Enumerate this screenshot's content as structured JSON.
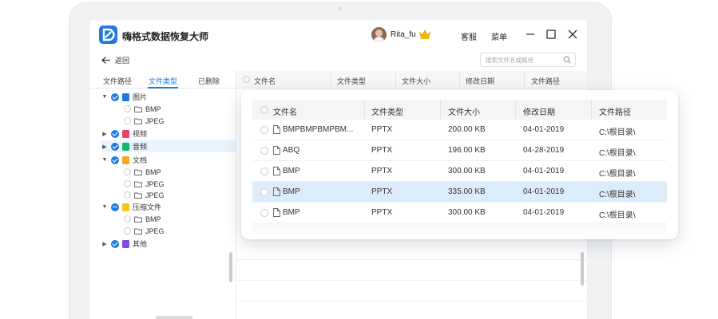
{
  "app": {
    "title": "嗨格式数据恢复大师",
    "user": "Rita_fu",
    "service_label": "客服",
    "menu_label": "菜单"
  },
  "nav": {
    "back_label": "返回",
    "search_placeholder": "搜索文件名或路径"
  },
  "left_tabs": [
    {
      "label": "文件路径",
      "active": false
    },
    {
      "label": "文件类型",
      "active": true
    },
    {
      "label": "已删除",
      "active": false
    }
  ],
  "tree": [
    {
      "label": "图片",
      "expanded": true,
      "checked": true,
      "color": "#1f7ae0"
    },
    {
      "label": "BMP",
      "child": true
    },
    {
      "label": "JPEG",
      "child": true
    },
    {
      "label": "视频",
      "expanded": false,
      "checked": true,
      "color": "#e8436f"
    },
    {
      "label": "音频",
      "expanded": false,
      "checked": true,
      "color": "#19b36b"
    },
    {
      "label": "文档",
      "expanded": true,
      "checked": true,
      "color": "#f5a623"
    },
    {
      "label": "BMP",
      "child": true
    },
    {
      "label": "JPEG",
      "child": true
    },
    {
      "label": "JPEG",
      "child": true
    },
    {
      "label": "压缩文件",
      "expanded": true,
      "checked": "partial",
      "color": "#f5c518"
    },
    {
      "label": "BMP",
      "child": true
    },
    {
      "label": "JPEG",
      "child": true
    },
    {
      "label": "其他",
      "expanded": false,
      "checked": true,
      "color": "#7b4fe0"
    }
  ],
  "bg_columns": [
    "文件名",
    "文件类型",
    "文件大小",
    "修改日期",
    "文件路径"
  ],
  "card": {
    "columns": [
      "文件名",
      "文件类型",
      "文件大小",
      "修改日期",
      "文件路径"
    ],
    "rows": [
      {
        "name": "BMPBMPBMPBM...",
        "type": "PPTX",
        "size": "200.00 KB",
        "date": "04-01-2019",
        "path": "C:\\根目录\\",
        "selected": false
      },
      {
        "name": "ABQ",
        "type": "PPTX",
        "size": "196.00 KB",
        "date": "04-28-2019",
        "path": "C:\\根目录\\",
        "selected": false
      },
      {
        "name": "BMP",
        "type": "PPTX",
        "size": "300.00 KB",
        "date": "04-01-2019",
        "path": "C:\\根目录\\",
        "selected": false
      },
      {
        "name": "BMP",
        "type": "PPTX",
        "size": "335.00 KB",
        "date": "04-01-2019",
        "path": "C:\\根目录\\",
        "selected": true
      },
      {
        "name": "BMP",
        "type": "PPTX",
        "size": "300.00 KB",
        "date": "04-01-2019",
        "path": "C:\\根目录\\",
        "selected": false
      }
    ]
  },
  "colors": {
    "accent": "#1f7ae0",
    "selected_row": "#dcecfa"
  }
}
